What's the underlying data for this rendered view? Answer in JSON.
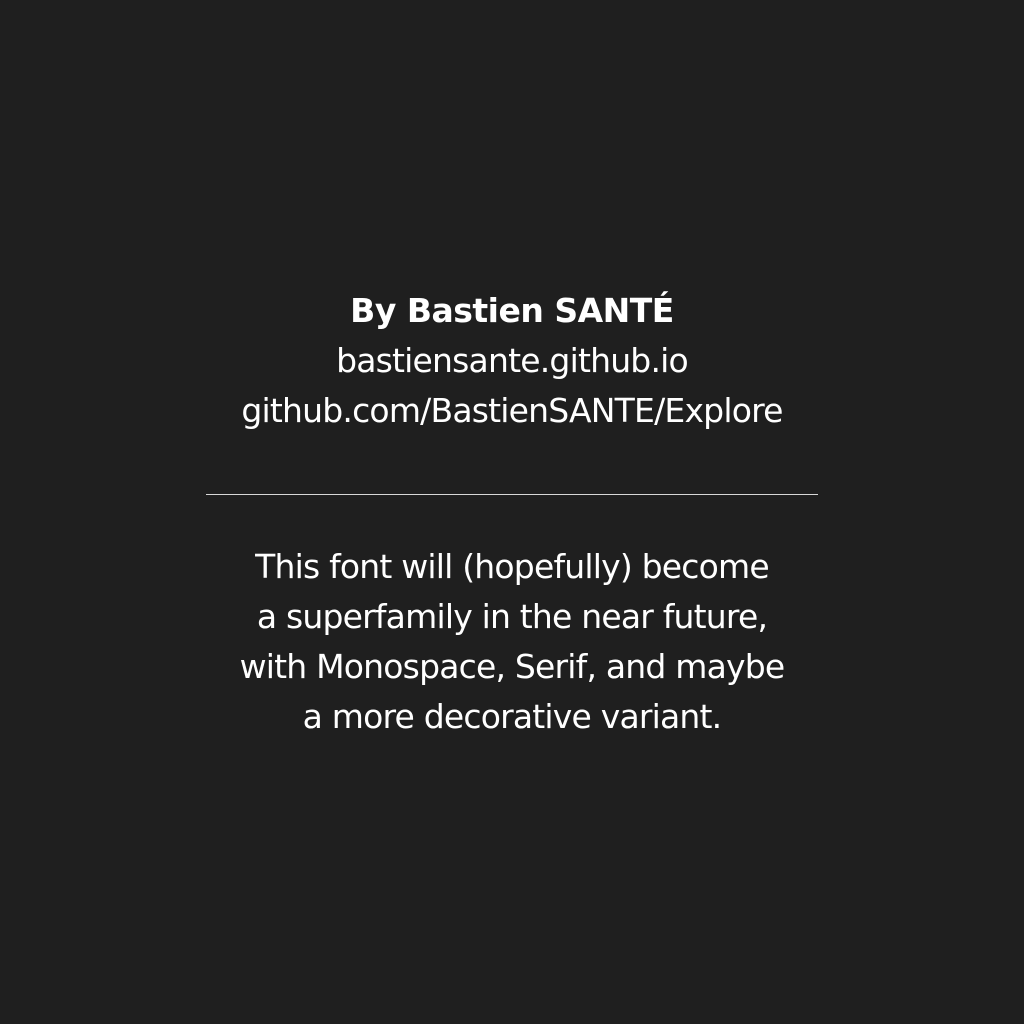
{
  "credits": {
    "author": "By Bastien SANTÉ",
    "website": "bastiensante.github.io",
    "repository": "github.com/BastienSANTE/Explore"
  },
  "note": {
    "lines": [
      "This font will (hopefully) become",
      "a superfamily in the near future,",
      "with Monospace, Serif, and maybe",
      "a more decorative variant."
    ]
  },
  "colors": {
    "background": "#1f1f1f",
    "text": "#ffffff",
    "divider": "#d8d8d8"
  }
}
